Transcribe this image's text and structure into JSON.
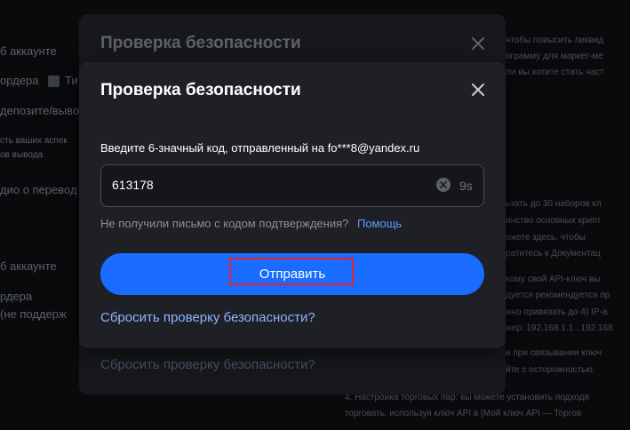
{
  "background": {
    "left_lines": [
      "б аккаунте",
      "ордера",
      "Ти",
      "депозите/выво",
      "сть ваших аспек",
      "ов вывода",
      "дио о перевод",
      "б аккаунте",
      "рдера",
      "(не поддерж"
    ],
    "right_lines": [
      "чтобы повысить ликвид",
      "ограмму для маркет-ме",
      "ли вы хотите стать част",
      "ьзать до 30 наборов кл",
      "инство основных крипт",
      "ожете здесь, чтобы",
      "ратитесь к Документац",
      "кому свой API-ключ вы",
      "дуется рекомендуется пр",
      "жно привязать до 4) IP-а",
      "жер: 192.168.1.1 . 192.168",
      "и при связывании ключ",
      "йте с осторожностью.",
      "4. Настройка торговых пар: вы можете установить подходя",
      "торговать, используя ключ API в [Мой ключ API — Торгов"
    ]
  },
  "back_modal": {
    "title": "Проверка безопасности",
    "reset_link": "Сбросить проверку безопасности?"
  },
  "modal": {
    "title": "Проверка безопасности",
    "close_icon": "close-icon",
    "prompt": "Введите 6-значный код, отправленный на fo***8@yandex.ru",
    "code_value": "613178",
    "clear_icon": "clear-circle-icon",
    "timer": "9s",
    "help_text": "Не получили письмо с кодом подтверждения?",
    "help_link": "Помощь",
    "submit_label": "Отправить",
    "reset_link": "Сбросить проверку безопасности?"
  },
  "colors": {
    "accent": "#1a6bff",
    "link": "#5b9bff",
    "highlight": "#e8202a",
    "modal_bg": "#1e2025"
  }
}
